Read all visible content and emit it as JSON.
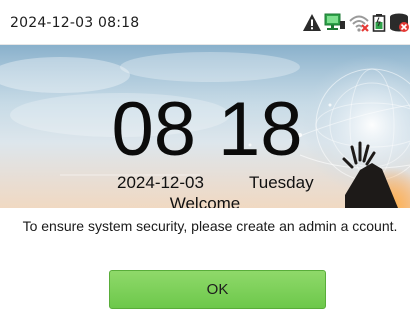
{
  "status_bar": {
    "datetime": "2024-12-03 08:18",
    "icons": [
      "warning-icon",
      "network-connected-icon",
      "wifi-disconnected-icon",
      "battery-icon",
      "server-icon"
    ]
  },
  "screensaver": {
    "time_hour": "08",
    "time_minute": "18",
    "date": "2024-12-03",
    "weekday": "Tuesday",
    "greeting": "Welcome"
  },
  "dialog": {
    "message": "To ensure system security, please create an admin a ccount.",
    "ok_label": "OK"
  },
  "colors": {
    "ok_button": "#74cc52",
    "warning": "#333333",
    "network": "#2fa34a",
    "disconnected": "#e53935"
  }
}
